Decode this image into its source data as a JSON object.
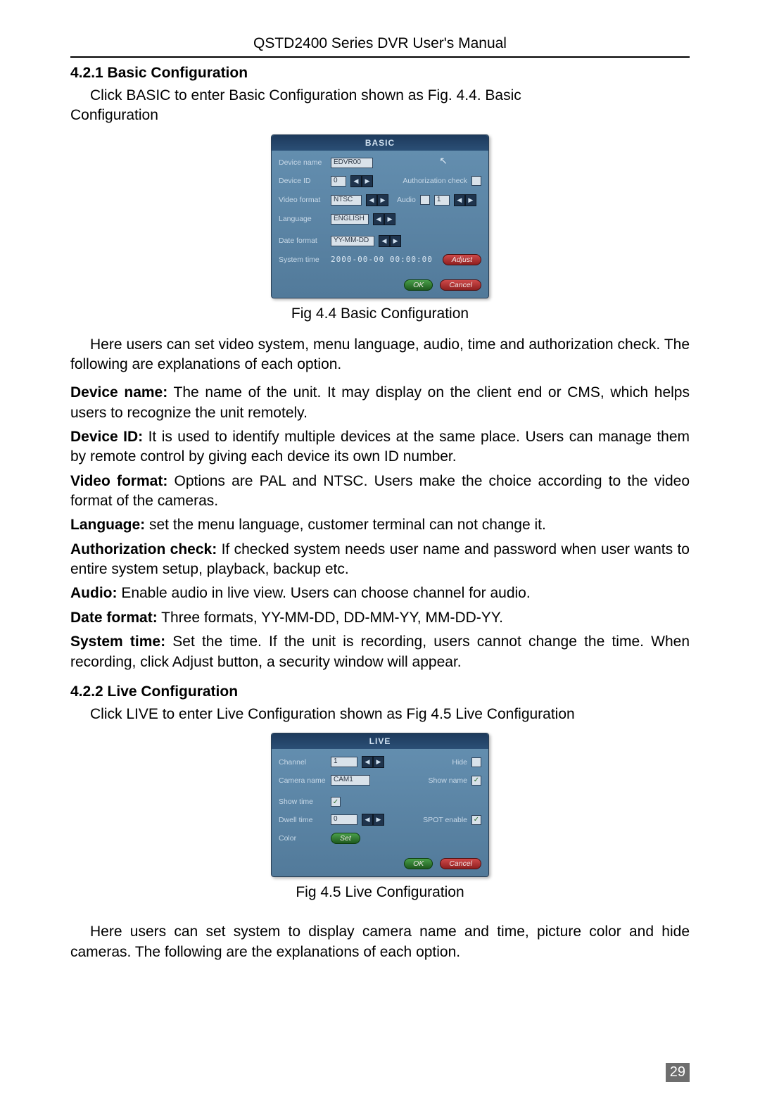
{
  "header": "QSTD2400 Series DVR User's Manual",
  "page_number": "29",
  "sections": {
    "basic": {
      "heading": "4.2.1  Basic Configuration",
      "intro_line1": "Click BASIC to enter Basic Configuration shown as Fig. 4.4. Basic",
      "intro_line2": "Configuration",
      "caption": "Fig 4.4    Basic Configuration",
      "para1": "Here users can set video system, menu language, audio, time and authorization check. The following are explanations of each option.",
      "options": [
        {
          "label": "Device name:",
          "text": " The name of the unit. It may display on the client end or CMS, which helps users to recognize the unit remotely."
        },
        {
          "label": "Device ID:",
          "text": " It is used to identify multiple devices at the same place. Users can manage them by remote control by giving each device its own ID number."
        },
        {
          "label": "Video format:",
          "text": " Options are PAL and NTSC. Users make the choice according to the video format of the cameras."
        },
        {
          "label": "Language:",
          "text": " set the menu language, customer terminal can not change it."
        },
        {
          "label": "Authorization check:",
          "text": " If checked system needs user name and password when user wants to entire system setup, playback, backup etc."
        },
        {
          "label": "Audio:",
          "text": " Enable audio in live view. Users can choose channel for audio."
        },
        {
          "label": "Date format:",
          "text": " Three formats, YY-MM-DD, DD-MM-YY, MM-DD-YY."
        },
        {
          "label": "System time:",
          "text": " Set the time. If the unit is recording, users cannot change the time. When recording, click Adjust button, a security window will appear."
        }
      ]
    },
    "live": {
      "heading": "4.2.2  Live Configuration",
      "intro": "Click LIVE to enter Live Configuration shown as Fig 4.5    Live Configuration",
      "caption": "Fig 4.5    Live Configuration",
      "para1": "Here users can set system to display camera name and time, picture color and hide cameras. The following are the explanations of each option."
    }
  },
  "dlg_basic": {
    "title": "BASIC",
    "rows": {
      "device_name": {
        "label": "Device name",
        "value": "EDVR00"
      },
      "device_id": {
        "label": "Device ID",
        "value": "0"
      },
      "auth_check": {
        "label": "Authorization check"
      },
      "video_format": {
        "label": "Video format",
        "value": "NTSC"
      },
      "audio": {
        "label": "Audio",
        "value": "1"
      },
      "language": {
        "label": "Language",
        "value": "ENGLISH"
      },
      "date_format": {
        "label": "Date format",
        "value": "YY-MM-DD"
      },
      "system_time": {
        "label": "System time",
        "value": "2000-00-00 00:00:00"
      }
    },
    "buttons": {
      "adjust": "Adjust",
      "ok": "OK",
      "cancel": "Cancel"
    }
  },
  "dlg_live": {
    "title": "LIVE",
    "rows": {
      "channel": {
        "label": "Channel",
        "value": "1"
      },
      "hide": {
        "label": "Hide"
      },
      "camera_name": {
        "label": "Camera name",
        "value": "CAM1"
      },
      "show_name": {
        "label": "Show name"
      },
      "show_time": {
        "label": "Show time"
      },
      "dwell_time": {
        "label": "Dwell time",
        "value": "0"
      },
      "spot_enable": {
        "label": "SPOT enable"
      },
      "color": {
        "label": "Color"
      }
    },
    "buttons": {
      "set": "Set",
      "ok": "OK",
      "cancel": "Cancel"
    }
  }
}
